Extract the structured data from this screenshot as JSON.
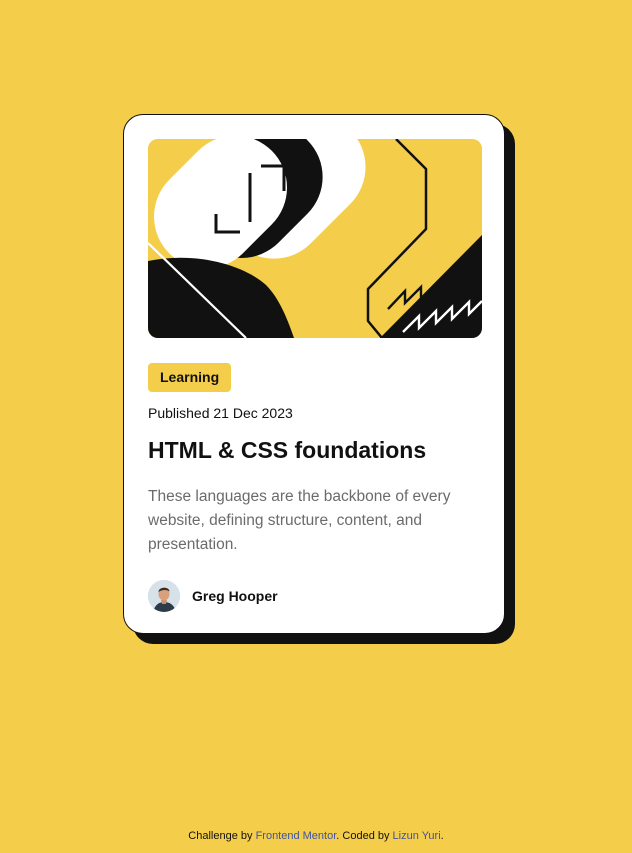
{
  "card": {
    "tag": "Learning",
    "published_label": "Published",
    "published_date": "21 Dec 2023",
    "title": "HTML & CSS foundations",
    "description": "These languages are the backbone of every website, defining structure, content, and presentation.",
    "author_name": "Greg Hooper",
    "hero_icon": "abstract-illustration",
    "avatar_icon": "person-avatar"
  },
  "attribution": {
    "prefix": "Challenge by",
    "challenge_link": "Frontend Mentor",
    "middle": ". Coded by",
    "coder_link": "Lizun Yuri",
    "suffix": "."
  },
  "colors": {
    "background": "#F4CE4B",
    "card": "#FFFFFF",
    "ink": "#111111",
    "muted_text": "#6B6B6B",
    "link": "#3E52A3"
  }
}
